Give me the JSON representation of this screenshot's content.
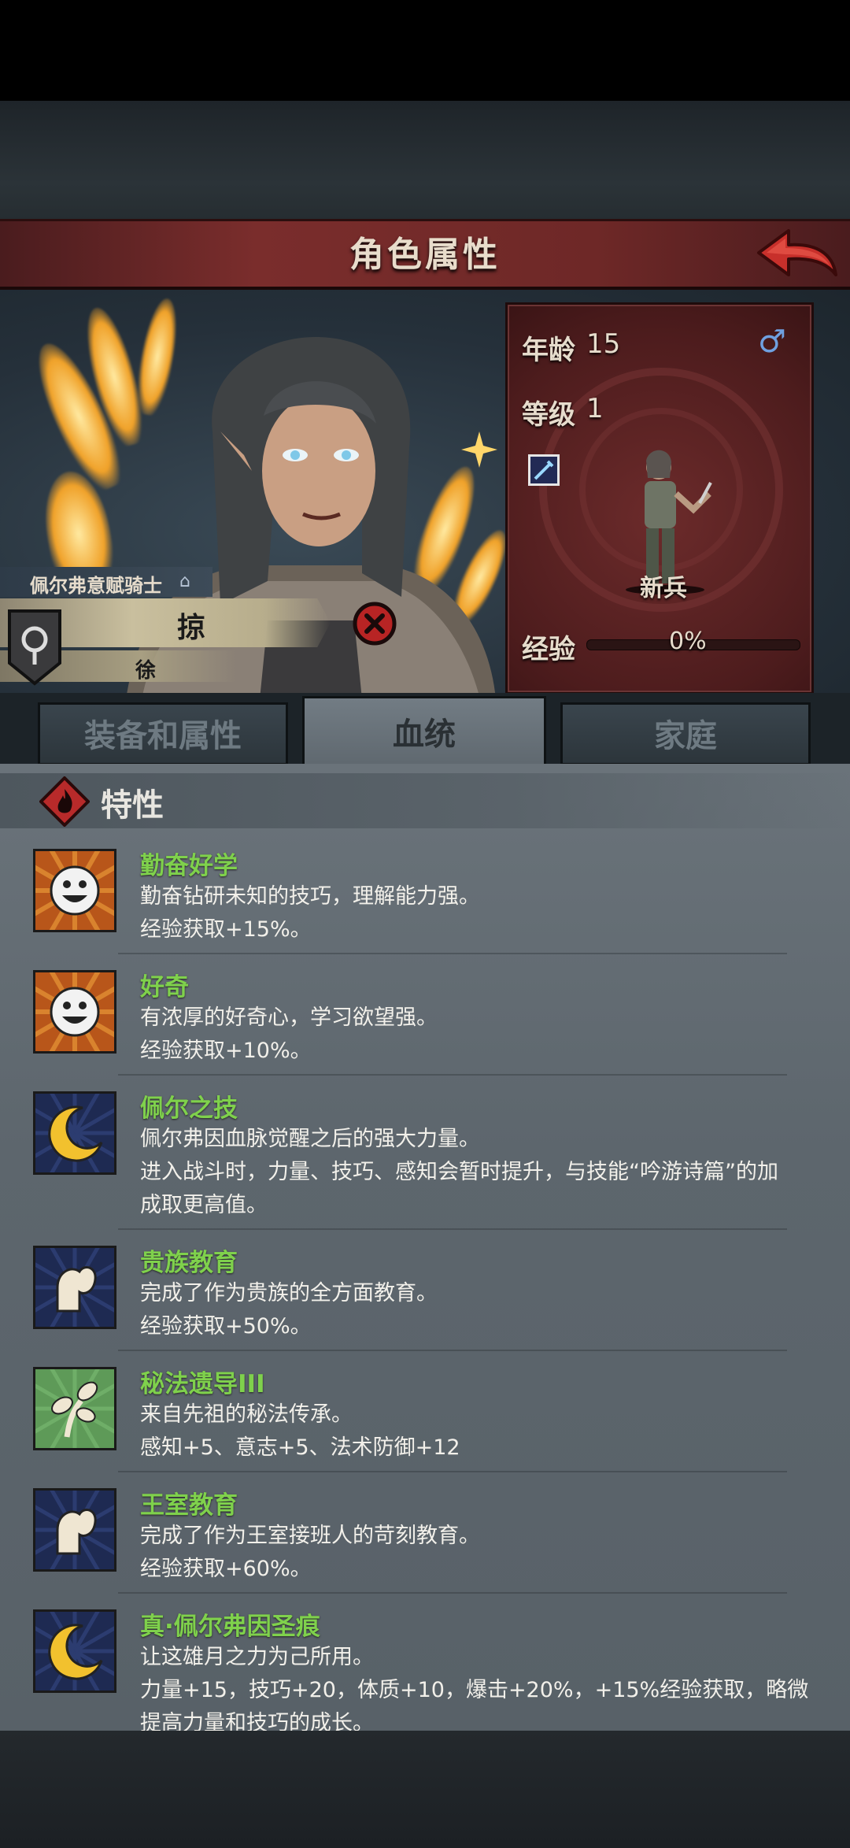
{
  "header": {
    "title": "角色属性"
  },
  "character": {
    "title": "佩尔弗意赋骑士",
    "name": "掠",
    "surname": "徐",
    "age_label": "年龄",
    "age": "15",
    "level_label": "等级",
    "level": "1",
    "class_name": "新兵",
    "exp_label": "经验",
    "exp_percent": "0%",
    "exp_fraction": 0
  },
  "tabs": [
    {
      "label": "装备和属性",
      "active": false
    },
    {
      "label": "血统",
      "active": true
    },
    {
      "label": "家庭",
      "active": false
    }
  ],
  "traits_section": {
    "title": "特性"
  },
  "traits": [
    {
      "icon": "smiley-icon",
      "name": "勤奋好学",
      "lines": [
        "勤奋钻研未知的技巧，理解能力强。",
        "经验获取+15%。"
      ]
    },
    {
      "icon": "smiley-icon",
      "name": "好奇",
      "lines": [
        "有浓厚的好奇心，学习欲望强。",
        "经验获取+10%。"
      ]
    },
    {
      "icon": "moon-icon",
      "name": "佩尔之技",
      "lines": [
        "佩尔弗因血脉觉醒之后的强大力量。",
        "进入战斗时，力量、技巧、感知会暂时提升，与技能“吟游诗篇”的加",
        "成取更高值。"
      ]
    },
    {
      "icon": "arm-icon",
      "name": "贵族教育",
      "lines": [
        "完成了作为贵族的全方面教育。",
        "经验获取+50%。"
      ]
    },
    {
      "icon": "leaf-icon",
      "name": "秘法遗导III",
      "lines": [
        "来自先祖的秘法传承。",
        "感知+5、意志+5、法术防御+12"
      ]
    },
    {
      "icon": "arm-icon",
      "name": "王室教育",
      "lines": [
        "完成了作为王室接班人的苛刻教育。",
        "经验获取+60%。"
      ]
    },
    {
      "icon": "moon-icon",
      "name": "真·佩尔弗因圣痕",
      "lines": [
        "让这雄月之力为己所用。",
        "力量+15，技巧+20，体质+10，爆击+20%，+15%经验获取，略微",
        "提高力量和技巧的成长。"
      ]
    }
  ],
  "colors": {
    "accent_red": "#7a2d2c",
    "trait_name": "#7fd14c",
    "card_bg": "#5a2223"
  }
}
